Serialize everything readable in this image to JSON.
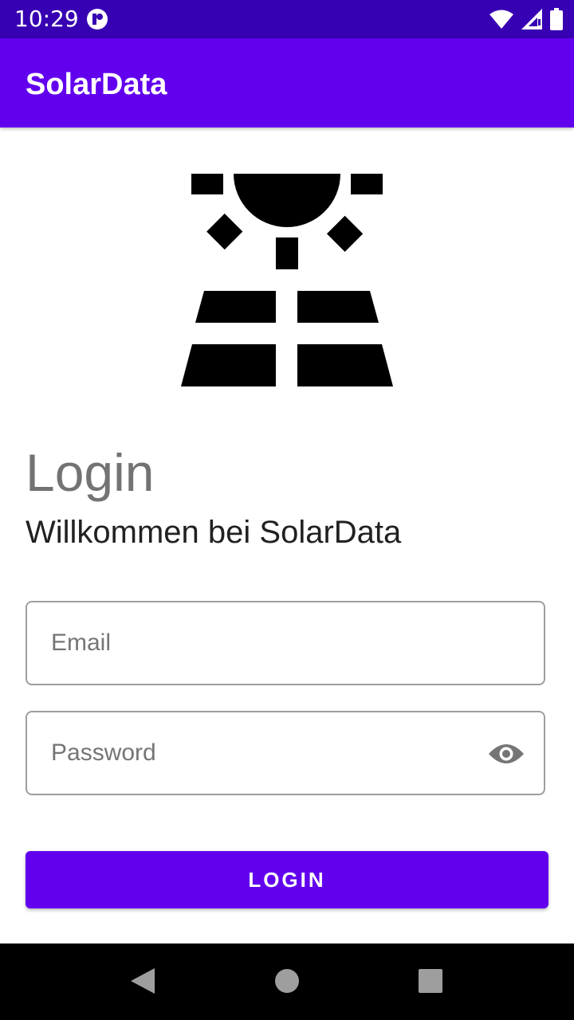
{
  "status_bar": {
    "time": "10:29",
    "icons": [
      "app-notification-icon",
      "wifi-icon",
      "signal-icon",
      "battery-icon"
    ]
  },
  "app_bar": {
    "title": "SolarData"
  },
  "logo": {
    "icon": "solar-panel-sun-icon"
  },
  "login": {
    "heading": "Login",
    "welcome": "Willkommen bei SolarData"
  },
  "form": {
    "email": {
      "placeholder": "Email",
      "value": ""
    },
    "password": {
      "placeholder": "Password",
      "value": "",
      "toggle_icon": "eye-icon"
    },
    "submit_label": "LOGIN"
  },
  "nav_bar": {
    "icons": [
      "back-icon",
      "home-icon",
      "recents-icon"
    ]
  },
  "colors": {
    "status_bar": "#3700B3",
    "primary": "#6200EE",
    "heading_gray": "#737373",
    "text_dark": "#212121",
    "field_border": "#9e9e9e"
  }
}
